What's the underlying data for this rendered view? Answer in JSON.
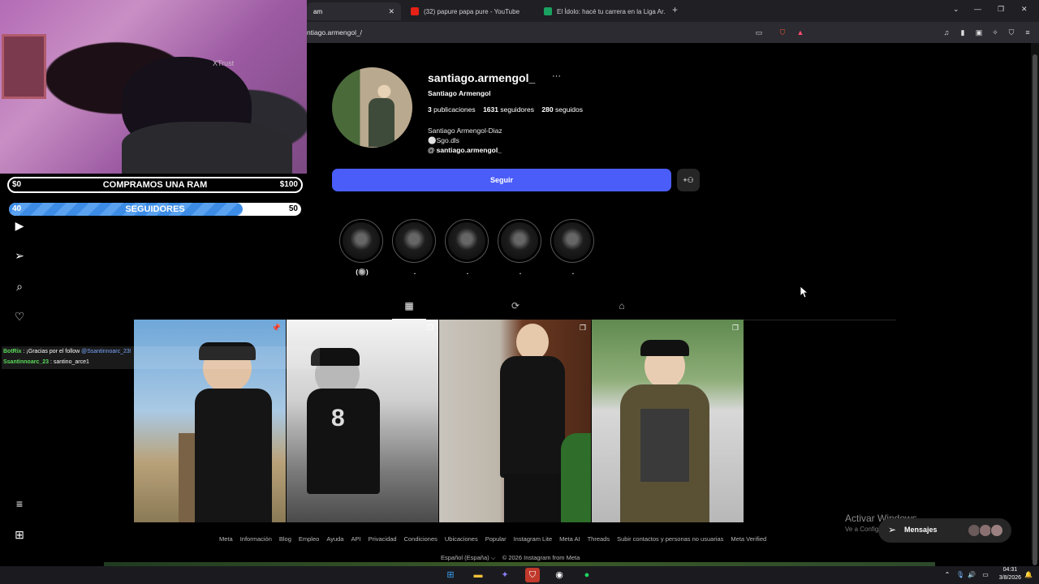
{
  "browser": {
    "tabs": [
      {
        "title": "am",
        "active": true
      },
      {
        "title": "(32) papure papa pure - YouTube",
        "active": false
      },
      {
        "title": "El Ídolo: hacé tu carrera en la Liga Ar...",
        "active": false
      }
    ],
    "url": "ntiago.armengol_/"
  },
  "stream_overlay": {
    "cam_brand": "XTrust",
    "bar1": {
      "left": "$0",
      "title": "COMPRAMOS UNA RAM",
      "right": "$100",
      "progress": 0
    },
    "bar2": {
      "left": "40",
      "title": "SEGUIDORES",
      "right": "50",
      "progress": 0.8
    },
    "chat": [
      {
        "user": "BotRix",
        "sep": ":",
        "message": "¡Gracias por el follow ",
        "mention": "@Ssantinnoarc_23!"
      },
      {
        "user": "Ssantinnoarc_23",
        "sep": ":",
        "message": "santino_arce1",
        "mention": ""
      }
    ]
  },
  "profile": {
    "username": "santiago.armengol_",
    "more": "···",
    "full_name": "Santiago Armengol",
    "posts_count": "3",
    "posts_label": "publicaciones",
    "followers_count": "1631",
    "followers_label": "seguidores",
    "following_count": "280",
    "following_label": "seguidos",
    "bio_line1": "Santiago Armengol-Diaz",
    "bio_line2": "⚪Sgo.dls",
    "threads_handle": "santiago.armengol_",
    "follow_button": "Seguir",
    "highlights": [
      {
        "label": "(🔘)"
      },
      {
        "label": "."
      },
      {
        "label": "."
      },
      {
        "label": "."
      },
      {
        "label": "."
      }
    ]
  },
  "footer": {
    "links": [
      "Meta",
      "Información",
      "Blog",
      "Empleo",
      "Ayuda",
      "API",
      "Privacidad",
      "Condiciones",
      "Ubicaciones",
      "Popular",
      "Instagram Lite",
      "Meta AI",
      "Threads",
      "Subir contactos y personas no usuarias",
      "Meta Verified"
    ],
    "language": "Español (España) ⌵",
    "copyright": "© 2026 Instagram from Meta"
  },
  "windows": {
    "activate_title": "Activar Windows",
    "activate_sub": "Ve a Configuración para activar Windows.",
    "time": "04:31",
    "date": "3/8/2026"
  },
  "messages": {
    "label": "Mensajes"
  },
  "colors": {
    "follow": "#4a5df9",
    "accent_bar": "#3c8ce6",
    "background": "#000000"
  }
}
